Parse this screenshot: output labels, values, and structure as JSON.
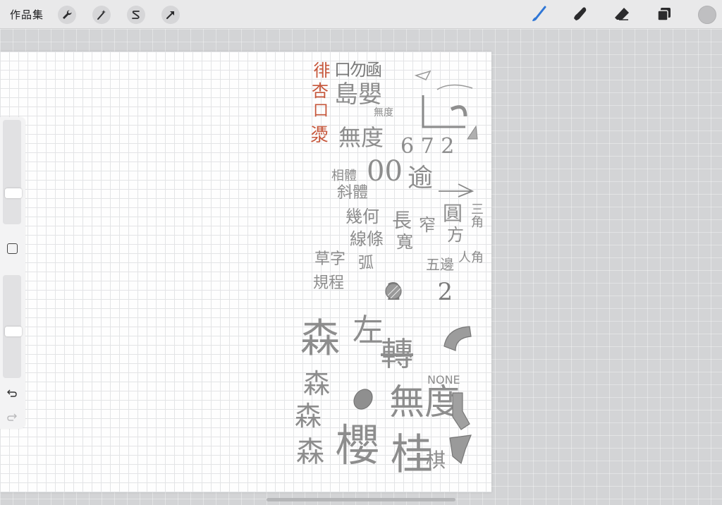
{
  "topbar": {
    "gallery_label": "作品集",
    "left_tools": [
      {
        "icon": "wrench-icon"
      },
      {
        "icon": "magic-wand-icon"
      },
      {
        "icon": "selection-s-icon"
      },
      {
        "icon": "transform-arrow-icon"
      }
    ],
    "right_tools": [
      {
        "icon": "brush-icon",
        "active": true,
        "color": "#2f76d6"
      },
      {
        "icon": "smudge-icon",
        "active": false
      },
      {
        "icon": "eraser-icon",
        "active": false
      },
      {
        "icon": "layers-icon",
        "active": false
      }
    ],
    "current_color": "#bfbfc1"
  },
  "sidebar": {
    "brush_size_level": 0.2,
    "opacity_level": 0.45
  },
  "sketches": {
    "red_column": [
      "徘",
      "杏",
      "口",
      "㵗"
    ],
    "row1": "口勿凾",
    "row2": "島嬰",
    "small1": "無度",
    "mueh": "無度",
    "zero": "00",
    "num": "6 7 2",
    "yu": "逾",
    "xiti": "相體",
    "xieti": "斜體",
    "jihe": "幾何",
    "xiantiao": "線條",
    "chang": "長",
    "kuan": "寬",
    "zhai": "窄",
    "yuan": "圓",
    "fang": "方",
    "sanjiao": "三角",
    "caozi": "草字",
    "guize": "規程",
    "huhu": "弧",
    "wuzhe": "五邊",
    "ren": "人角",
    "twos": "2 2",
    "forest1": "森",
    "zuo": "左",
    "zhuan": "轉",
    "forest2": "森",
    "forest3": "森",
    "forest4": "森",
    "none": "NONE",
    "wudu": "無度",
    "ying": "櫻",
    "gui": "桂",
    "ne": "棋"
  }
}
